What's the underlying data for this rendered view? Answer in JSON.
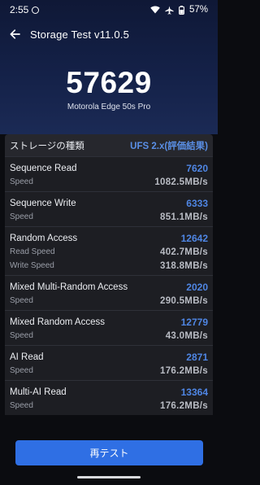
{
  "status_bar": {
    "time": "2:55",
    "battery": "57%",
    "icons": [
      "notification-circle-icon",
      "wifi-icon",
      "airplane-icon",
      "battery-icon"
    ]
  },
  "app_bar": {
    "title": "Storage Test v11.0.5"
  },
  "summary": {
    "score": "57629",
    "device": "Motorola Edge 50s Pro"
  },
  "storage_type": {
    "label": "ストレージの種類",
    "value": "UFS 2.x(評価結果)"
  },
  "tests": [
    {
      "name": "Sequence Read",
      "score": "7620",
      "subs": [
        {
          "label": "Speed",
          "value": "1082.5MB/s"
        }
      ]
    },
    {
      "name": "Sequence Write",
      "score": "6333",
      "subs": [
        {
          "label": "Speed",
          "value": "851.1MB/s"
        }
      ]
    },
    {
      "name": "Random Access",
      "score": "12642",
      "subs": [
        {
          "label": "Read Speed",
          "value": "402.7MB/s"
        },
        {
          "label": "Write Speed",
          "value": "318.8MB/s"
        }
      ]
    },
    {
      "name": "Mixed Multi-Random Access",
      "score": "2020",
      "subs": [
        {
          "label": "Speed",
          "value": "290.5MB/s"
        }
      ]
    },
    {
      "name": "Mixed Random Access",
      "score": "12779",
      "subs": [
        {
          "label": "Speed",
          "value": "43.0MB/s"
        }
      ]
    },
    {
      "name": "AI Read",
      "score": "2871",
      "subs": [
        {
          "label": "Speed",
          "value": "176.2MB/s"
        }
      ]
    },
    {
      "name": "Multi-AI Read",
      "score": "13364",
      "subs": [
        {
          "label": "Speed",
          "value": "176.2MB/s"
        }
      ]
    }
  ],
  "actions": {
    "retest_label": "再テスト"
  },
  "colors": {
    "accent": "#2f6fe4",
    "score_blue": "#4f86e4",
    "background": "#0b0c10",
    "hero_top": "#0f1836"
  }
}
